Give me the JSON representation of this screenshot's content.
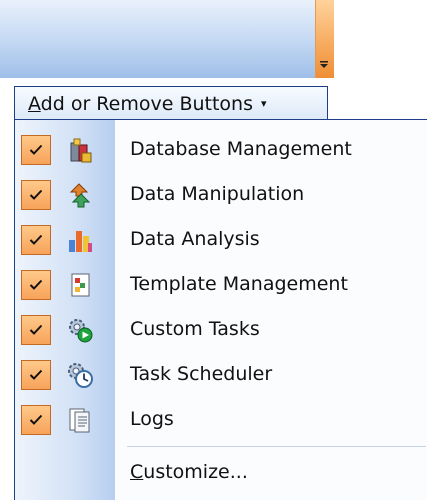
{
  "header": {
    "prefix_underlined": "A",
    "label_rest": "dd or Remove Buttons",
    "caret": "▾"
  },
  "menu": {
    "items": [
      {
        "label": "Database Management",
        "checked": true,
        "icon": "database-management-icon"
      },
      {
        "label": "Data Manipulation",
        "checked": true,
        "icon": "data-manipulation-icon"
      },
      {
        "label": "Data Analysis",
        "checked": true,
        "icon": "data-analysis-icon"
      },
      {
        "label": "Template Management",
        "checked": true,
        "icon": "template-management-icon"
      },
      {
        "label": "Custom Tasks",
        "checked": true,
        "icon": "custom-tasks-icon"
      },
      {
        "label": "Task Scheduler",
        "checked": true,
        "icon": "task-scheduler-icon"
      },
      {
        "label": "Logs",
        "checked": true,
        "icon": "logs-icon"
      }
    ],
    "customize_underlined": "C",
    "customize_rest": "ustomize..."
  },
  "colors": {
    "accent_orange": "#f7a35a",
    "border_blue": "#1f3e8a",
    "gutter_blue": "#b7cef0"
  }
}
